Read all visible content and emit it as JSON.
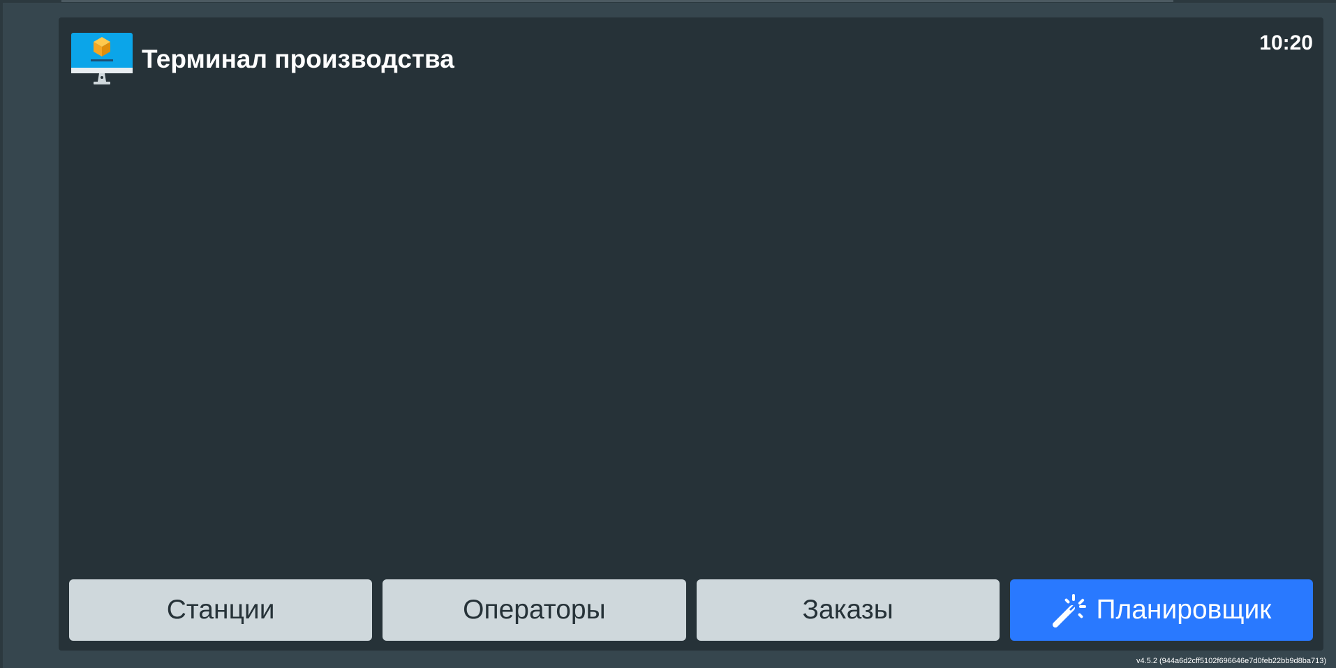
{
  "header": {
    "title": "Терминал производства",
    "clock": "10:20"
  },
  "nav": {
    "buttons": [
      {
        "label": "Станции"
      },
      {
        "label": "Операторы"
      },
      {
        "label": "Заказы"
      },
      {
        "label": "Планировщик",
        "icon": "magic-wand-icon"
      }
    ]
  },
  "footer": {
    "version": "v4.5.2 (944a6d2cff5102f696646e7d0feb22bb9d8ba713)"
  },
  "colors": {
    "background": "#37474f",
    "panel": "#263238",
    "button": "#cfd8dc",
    "button_text": "#263238",
    "accent": "#2979ff",
    "logo_screen": "#0ba5e9",
    "logo_box": "#f5a623"
  }
}
